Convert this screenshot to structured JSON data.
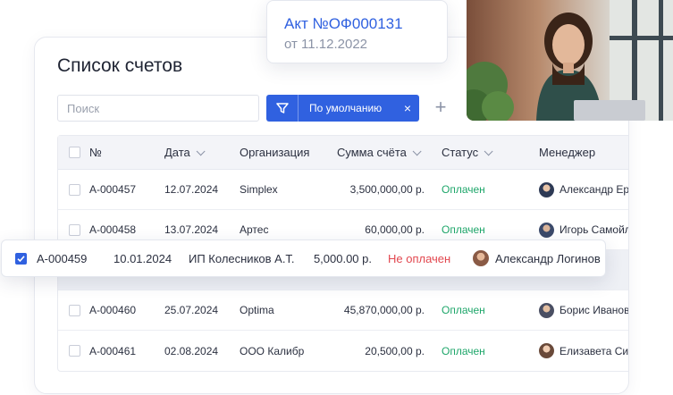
{
  "page": {
    "title": "Список счетов"
  },
  "search": {
    "placeholder": "Поиск"
  },
  "filter": {
    "label": "По умолчанию",
    "close": "×"
  },
  "add_button": {
    "label": "+"
  },
  "table": {
    "headers": {
      "num": "№",
      "date": "Дата",
      "org": "Организация",
      "sum": "Сумма счёта",
      "status": "Статус",
      "manager": "Менеджер"
    },
    "rows": [
      {
        "num": "А-000457",
        "date": "12.07.2024",
        "org": "Simplex",
        "sum": "3,500,000,00 р.",
        "status": "Оплачен",
        "manager": "Александр Ер"
      },
      {
        "num": "А-000458",
        "date": "13.07.2024",
        "org": "Артес",
        "sum": "60,000,00 р.",
        "status": "Оплачен",
        "manager": "Игорь Самойл"
      },
      {
        "num": "А-000460",
        "date": "25.07.2024",
        "org": "Optima",
        "sum": "45,870,000,00 р.",
        "status": "Оплачен",
        "manager": "Борис Иванов"
      },
      {
        "num": "А-000461",
        "date": "02.08.2024",
        "org": "ООО Калибр",
        "sum": "20,500,00 р.",
        "status": "Оплачен",
        "manager": "Елизавета Си"
      }
    ]
  },
  "selected_row": {
    "num": "А-000459",
    "date": "10.01.2024",
    "org": "ИП Колесников А.Т.",
    "sum": "5,000.00 р.",
    "status": "Не оплачен",
    "manager": "Александр Логинов"
  },
  "act_card": {
    "title": "Акт №ОФ000131",
    "date": "от 11.12.2022"
  },
  "colors": {
    "accent": "#3061e0",
    "paid": "#1ea66a",
    "unpaid": "#e2474f"
  },
  "icons": {
    "filter": "funnel-icon",
    "close": "close-icon",
    "add": "plus-icon",
    "sort": "chevron-down-icon",
    "checkbox": "checkbox-icon"
  }
}
